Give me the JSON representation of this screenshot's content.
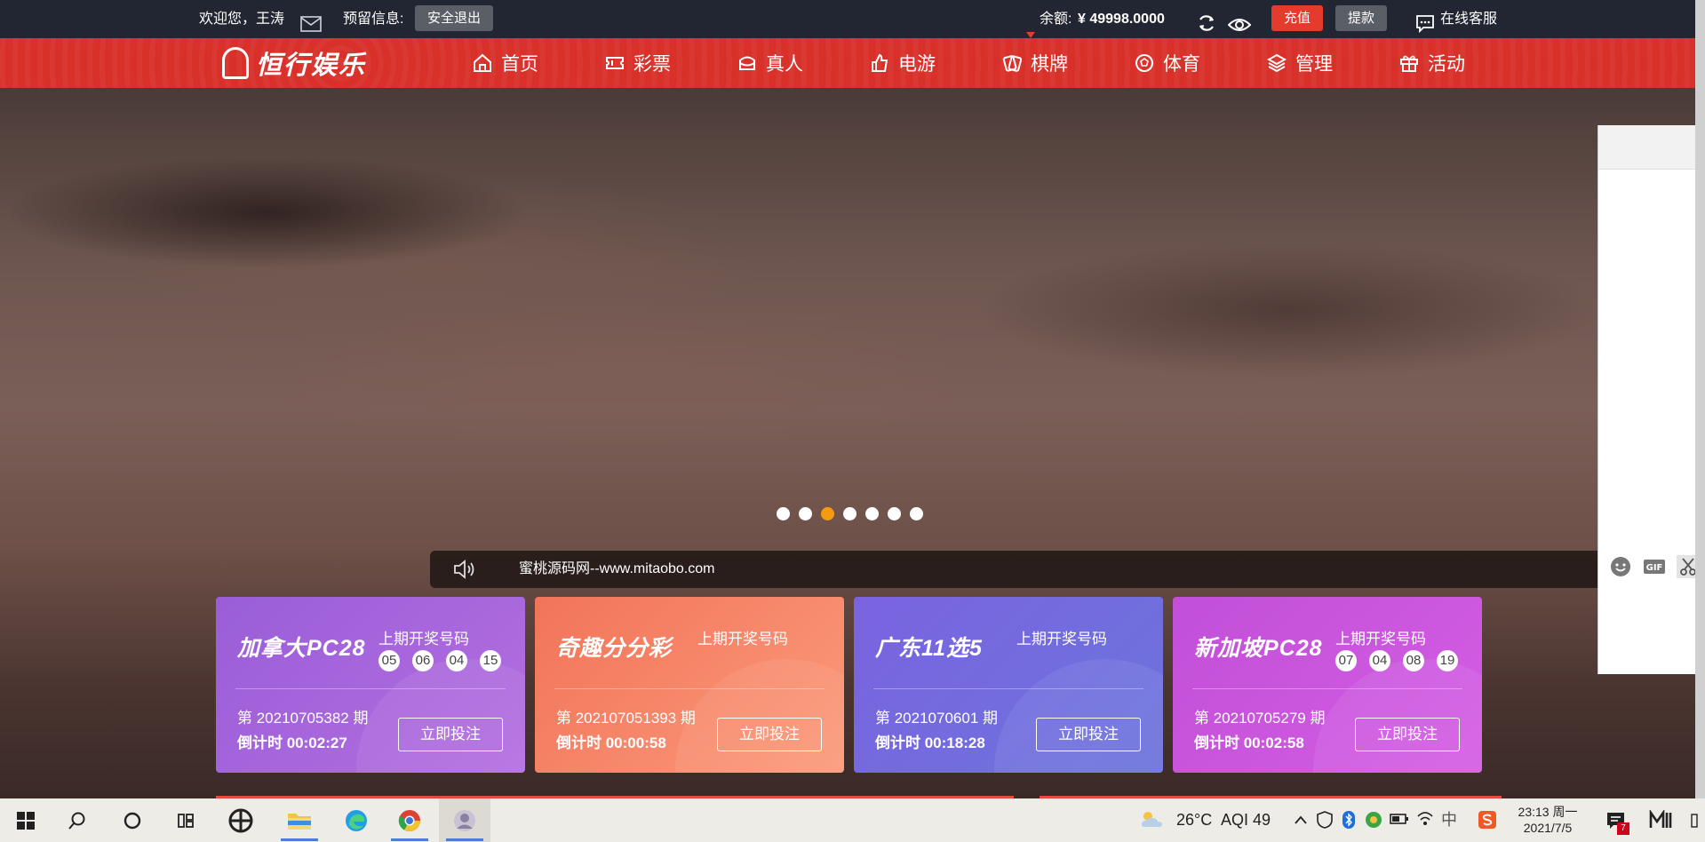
{
  "topbar": {
    "welcome": "欢迎您，王涛",
    "reserve_label": "预留信息:",
    "logout": "安全退出",
    "balance_label": "余额:",
    "balance_value": "¥ 49998.0000",
    "recharge": "充值",
    "withdraw": "提款",
    "support": "在线客服"
  },
  "nav": {
    "logo": "恒行娱乐",
    "items": [
      {
        "label": "首页",
        "icon": "home-icon"
      },
      {
        "label": "彩票",
        "icon": "ticket-icon"
      },
      {
        "label": "真人",
        "icon": "live-casino-icon"
      },
      {
        "label": "电游",
        "icon": "thumbs-up-icon"
      },
      {
        "label": "棋牌",
        "icon": "cards-icon"
      },
      {
        "label": "体育",
        "icon": "ball-icon"
      },
      {
        "label": "管理",
        "icon": "layers-icon"
      },
      {
        "label": "活动",
        "icon": "gift-icon"
      }
    ]
  },
  "carousel": {
    "count": 7,
    "active_index": 2
  },
  "notice": {
    "text": "蜜桃源码网--www.mitaobo.com"
  },
  "cards": [
    {
      "logo": "加拿大PC28",
      "last_label": "上期开奖号码",
      "balls": [
        "05",
        "06",
        "04",
        "15"
      ],
      "issue": "第 20210705382 期",
      "countdown": "倒计时 00:02:27",
      "bet": "立即投注",
      "color_start": "#9a5ed8",
      "color_end": "#b46ee0"
    },
    {
      "logo": "奇趣分分彩",
      "last_label": "上期开奖号码",
      "balls": [],
      "issue": "第 202107051393 期",
      "countdown": "倒计时 00:00:58",
      "bet": "立即投注",
      "color_start": "#f2745a",
      "color_end": "#fb9a7a"
    },
    {
      "logo": "广东11选5",
      "last_label": "上期开奖号码",
      "balls": [],
      "issue": "第 2021070601 期",
      "countdown": "倒计时 00:18:28",
      "bet": "立即投注",
      "color_start": "#7b63e0",
      "color_end": "#6b74dc"
    },
    {
      "logo": "新加坡PC28",
      "last_label": "上期开奖号码",
      "balls": [
        "07",
        "04",
        "08",
        "19"
      ],
      "issue": "第 20210705279 期",
      "countdown": "倒计时 00:02:58",
      "bet": "立即投注",
      "color_start": "#c24fd8",
      "color_end": "#d45ee4"
    }
  ],
  "taskbar": {
    "weather": "26°C",
    "aqi": "AQI 49",
    "ime": "中",
    "time": "23:13 周一",
    "date": "2021/7/5",
    "notify_count": "7"
  }
}
